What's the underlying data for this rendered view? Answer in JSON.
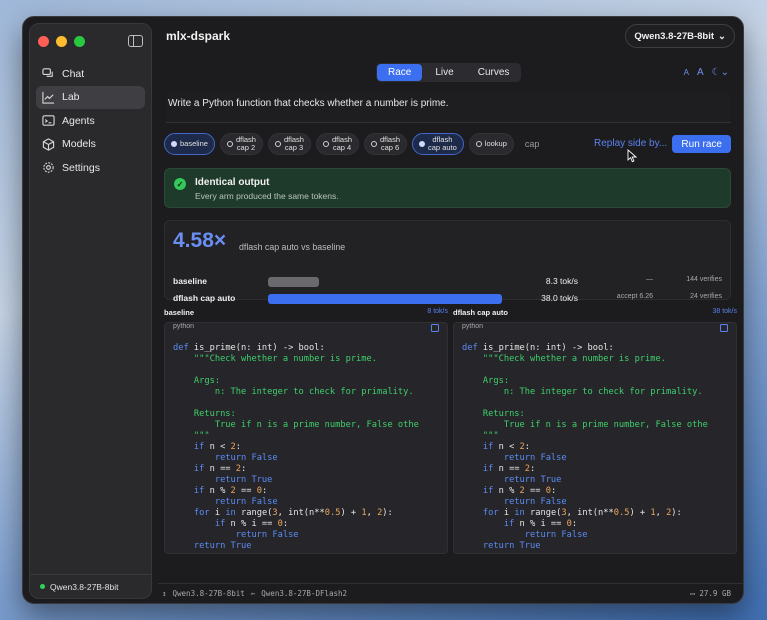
{
  "app": {
    "title": "mlx-dspark"
  },
  "model_select": {
    "value": "Qwen3.8-27B-8bit"
  },
  "sidebar": {
    "items": [
      {
        "label": "Chat",
        "icon": "chat-bubbles-icon",
        "active": false
      },
      {
        "label": "Lab",
        "icon": "chart-line-icon",
        "active": true
      },
      {
        "label": "Agents",
        "icon": "terminal-icon",
        "active": false
      },
      {
        "label": "Models",
        "icon": "cube-icon",
        "active": false
      },
      {
        "label": "Settings",
        "icon": "gear-icon",
        "active": false
      }
    ],
    "footer_model": "Qwen3.8-27B-8bit"
  },
  "tabs": [
    {
      "label": "Race",
      "active": true
    },
    {
      "label": "Live",
      "active": false
    },
    {
      "label": "Curves",
      "active": false
    }
  ],
  "toolbar_right": {
    "a_small": "A",
    "a_big": "A",
    "theme_icon": "moon-icon"
  },
  "prompt": {
    "text": "Write a Python function that checks whether a number is prime."
  },
  "chips": [
    {
      "line1": "baseline",
      "line2": "",
      "selected": true
    },
    {
      "line1": "dflash",
      "line2": "cap 2",
      "selected": false
    },
    {
      "line1": "dflash",
      "line2": "cap 3",
      "selected": false
    },
    {
      "line1": "dflash",
      "line2": "cap 4",
      "selected": false
    },
    {
      "line1": "dflash",
      "line2": "cap 6",
      "selected": false
    },
    {
      "line1": "dflash",
      "line2": "cap auto",
      "selected": true
    },
    {
      "line1": "lookup",
      "line2": "",
      "selected": false
    }
  ],
  "cap_placeholder": "cap",
  "actions": {
    "replay": "Replay side by...",
    "run": "Run race"
  },
  "banner": {
    "title": "Identical output",
    "subtitle": "Every arm produced the same tokens."
  },
  "stats": {
    "speedup": "4.58×",
    "speedup_desc": "dflash cap auto vs baseline",
    "rows": [
      {
        "name": "baseline",
        "rate": "8.3 tok/s",
        "extra": "—",
        "verifies": "144 verifies",
        "fill": 0.22,
        "color": "#6a6a6e"
      },
      {
        "name": "dflash cap auto",
        "rate": "38.0 tok/s",
        "extra": "accept 6.26",
        "verifies": "24 verifies",
        "fill": 1.0,
        "color": "#3b6ff0"
      }
    ]
  },
  "columns": [
    {
      "title": "baseline",
      "rate": "8 tok/s",
      "lang": "python"
    },
    {
      "title": "dflash cap auto",
      "rate": "38 tok/s",
      "lang": "python"
    }
  ],
  "code_lines": [
    "def is_prime(n: int) -> bool:",
    "    \"\"\"Check whether a number is prime.",
    "",
    "    Args:",
    "        n: The integer to check for primality.",
    "",
    "    Returns:",
    "        True if n is a prime number, False othe",
    "    \"\"\"",
    "    if n < 2:",
    "        return False",
    "    if n == 2:",
    "        return True",
    "    if n % 2 == 0:",
    "        return False",
    "    for i in range(3, int(n**0.5) + 1, 2):",
    "        if n % i == 0:",
    "            return False",
    "    return True"
  ],
  "statusbar": {
    "target": "Qwen3.8-27B-8bit",
    "arrow": "←",
    "draft": "Qwen3.8-27B-DFlash2",
    "memory": "27.9 GB"
  }
}
